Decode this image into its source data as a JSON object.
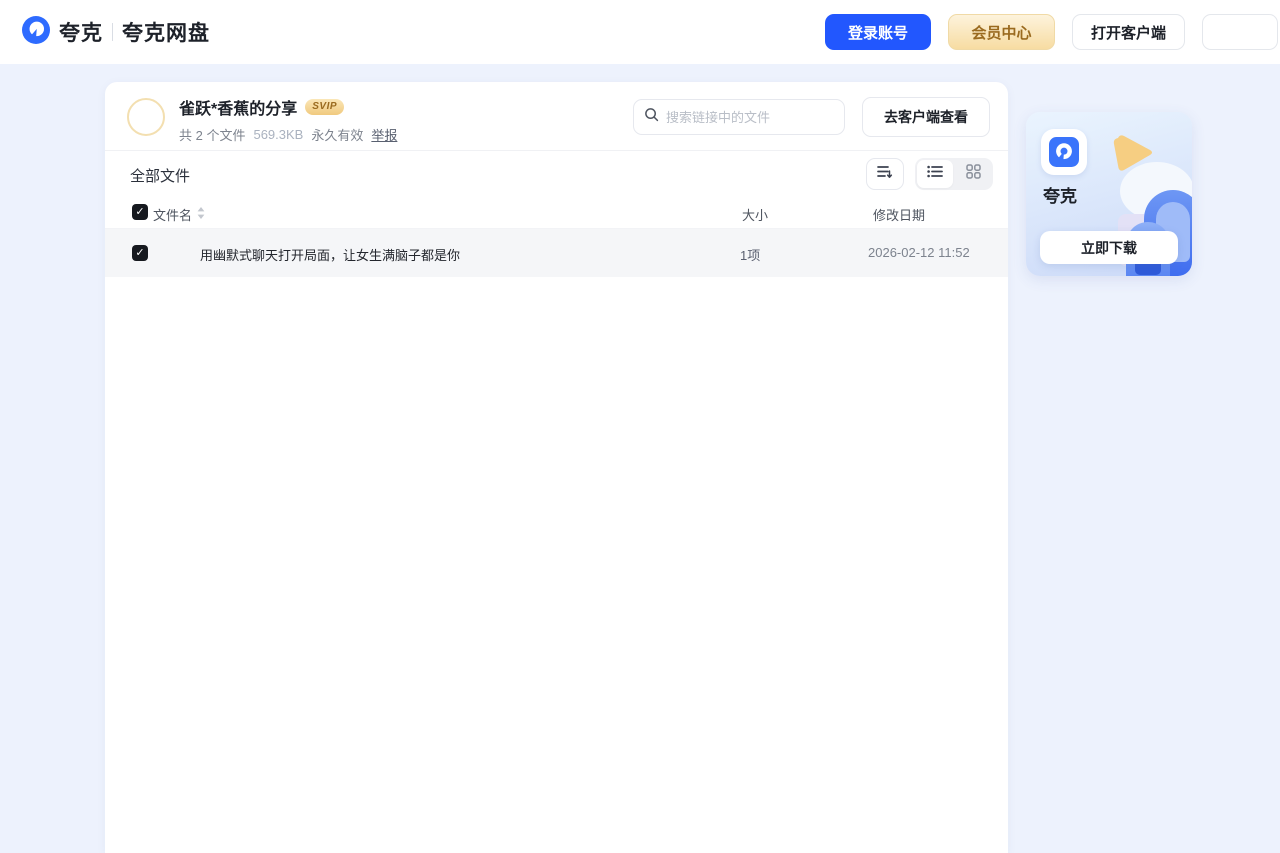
{
  "header": {
    "brand": "夸克",
    "product": "夸克网盘",
    "buttons": {
      "login": "登录账号",
      "vip": "会员中心",
      "client": "打开客户端"
    }
  },
  "share": {
    "title": "雀跃*香蕉的分享",
    "badge": "SVIP",
    "meta": {
      "files": "共 2 个文件",
      "size": "569.3KB",
      "validity": "永久有效",
      "report": "举报"
    },
    "search_placeholder": "搜索链接中的文件",
    "client_view_button": "去客户端查看"
  },
  "file_list": {
    "section_title": "全部文件",
    "columns": {
      "name": "文件名",
      "size": "大小",
      "date": "修改日期"
    },
    "rows": [
      {
        "name": "用幽默式聊天打开局面，让女生满脑子都是你",
        "size": "1项",
        "date": "2026-02-12 11:52",
        "checked": "✓"
      }
    ]
  },
  "promo": {
    "app_name": "夸克",
    "download_button": "立即下载"
  },
  "colors": {
    "accent_blue": "#2257FE",
    "vip_text": "#9A6A1F",
    "page_bg": "#EDF2FD",
    "selected_row_bg": "#F5F6F8"
  }
}
